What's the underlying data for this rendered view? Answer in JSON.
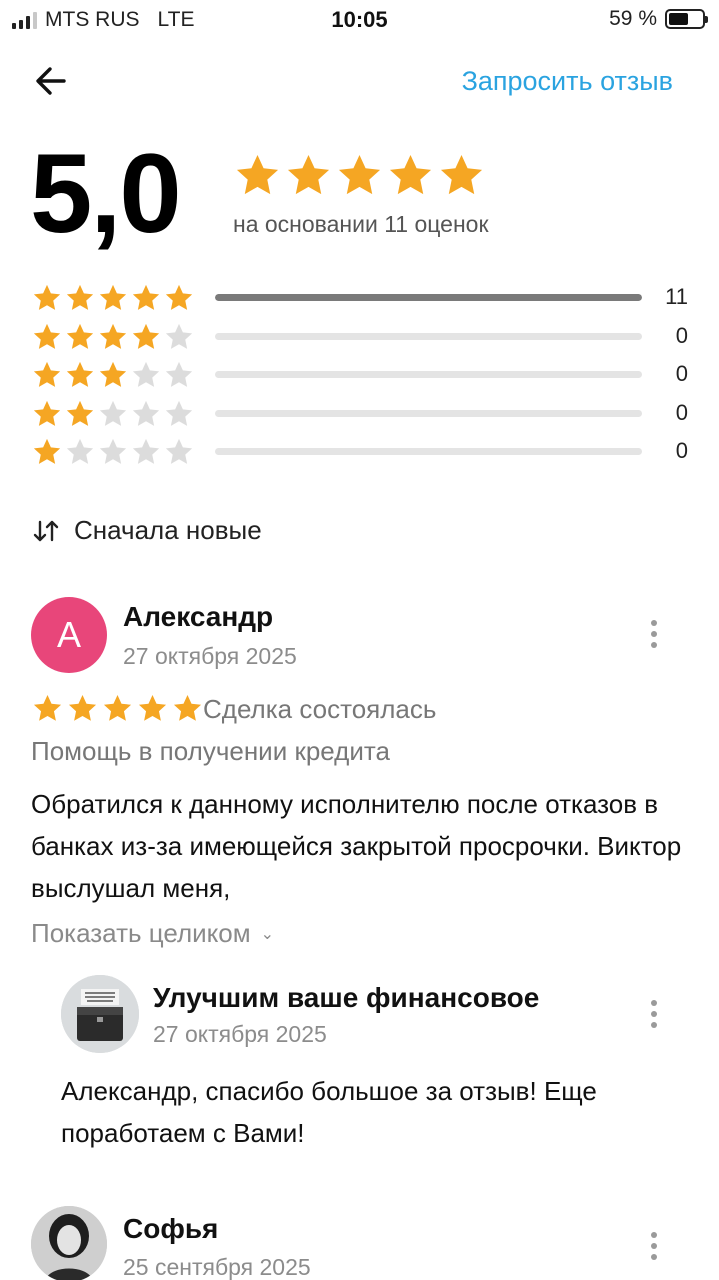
{
  "status_bar": {
    "carrier": "MTS RUS",
    "network": "LTE",
    "time": "10:05",
    "battery_label": "59 %",
    "battery_level": 0.59,
    "signal_bars": 3
  },
  "header": {
    "request_review_label": "Запросить отзыв"
  },
  "summary": {
    "score": "5,0",
    "stars": 5,
    "subtitle": "на основании 11 оценок"
  },
  "distribution": [
    {
      "stars": 5,
      "count": "11",
      "fraction": 1.0
    },
    {
      "stars": 4,
      "count": "0",
      "fraction": 0
    },
    {
      "stars": 3,
      "count": "0",
      "fraction": 0
    },
    {
      "stars": 2,
      "count": "0",
      "fraction": 0
    },
    {
      "stars": 1,
      "count": "0",
      "fraction": 0
    }
  ],
  "sort": {
    "label": "Сначала новые"
  },
  "reviews": [
    {
      "avatar_letter": "А",
      "author": "Александр",
      "date": "27 октября 2025",
      "rating": 5,
      "deal_status": "Сделка состоялась",
      "service": "Помощь в получении кредита",
      "text": "Обратился к данному исполнителю после отказов в банках из-за имеющейся закрытой просрочки. Виктор выслушал меня,",
      "show_more": "Показать целиком",
      "reply": {
        "author": "Улучшим ваше финансовое",
        "date": "27 октября 2025",
        "text": "Александр, спасибо большое за отзыв! Еще поработаем с Вами!"
      }
    },
    {
      "author": "Софья",
      "date": "25 сентября 2025"
    }
  ],
  "colors": {
    "accent": "#2aa3e0",
    "star": "#f5a623",
    "star_empty": "#dcdcdc",
    "avatar": "#e8467a"
  }
}
